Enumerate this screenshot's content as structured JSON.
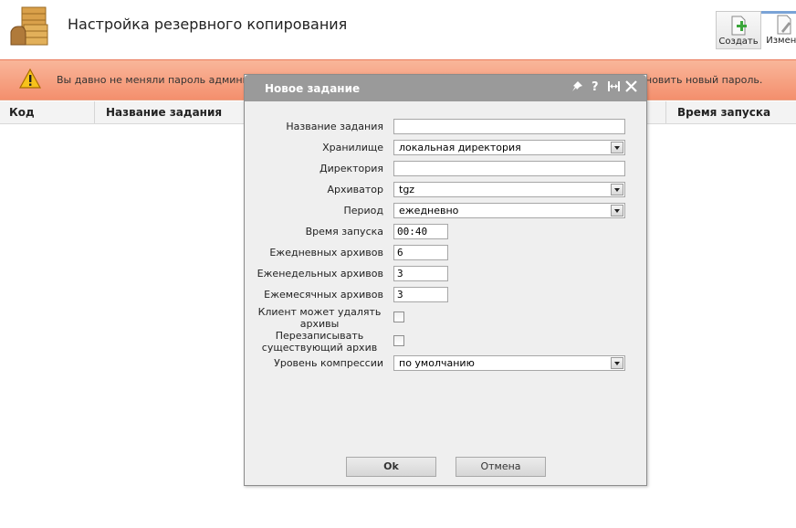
{
  "header": {
    "title": "Настройка резервного копирования",
    "logo_icon": "archive-boxes-icon",
    "toolbar": {
      "create_label": "Создать",
      "edit_label": "Измени"
    }
  },
  "warning": {
    "icon": "warning-icon",
    "text_left": "Вы давно не меняли пароль администрат",
    "text_right": "новить новый пароль."
  },
  "table": {
    "columns": [
      "Код",
      "Название задания",
      "Время запуска"
    ]
  },
  "dialog": {
    "title": "Новое задание",
    "controls": {
      "pin": "pin-icon",
      "help": "?",
      "resize": "resize-icon",
      "close": "close-icon"
    },
    "fields": {
      "job_name": {
        "label": "Название задания",
        "value": ""
      },
      "storage": {
        "label": "Хранилище",
        "value": "локальная директория"
      },
      "directory": {
        "label": "Директория",
        "value": ""
      },
      "archiver": {
        "label": "Архиватор",
        "value": "tgz"
      },
      "period": {
        "label": "Период",
        "value": "ежедневно"
      },
      "start_time": {
        "label": "Время запуска",
        "value": "00:40"
      },
      "daily_archives": {
        "label": "Ежедневных архивов",
        "value": "6"
      },
      "weekly_archives": {
        "label": "Еженедельных архивов",
        "value": "3"
      },
      "monthly_archives": {
        "label": "Ежемесячных архивов",
        "value": "3"
      },
      "client_can_delete": {
        "label": "Клиент может удалять архивы",
        "checked": false
      },
      "overwrite_existing": {
        "label": "Перезаписывать существующий архив",
        "checked": false
      },
      "compression_level": {
        "label": "Уровень компрессии",
        "value": "по умолчанию"
      }
    },
    "buttons": {
      "ok": "Ok",
      "cancel": "Отмена"
    }
  },
  "colors": {
    "warning_bar": "#f48f6d",
    "dialog_titlebar": "#9a9a9a",
    "dialog_body": "#efefef",
    "table_header": "#f3f3f3"
  }
}
